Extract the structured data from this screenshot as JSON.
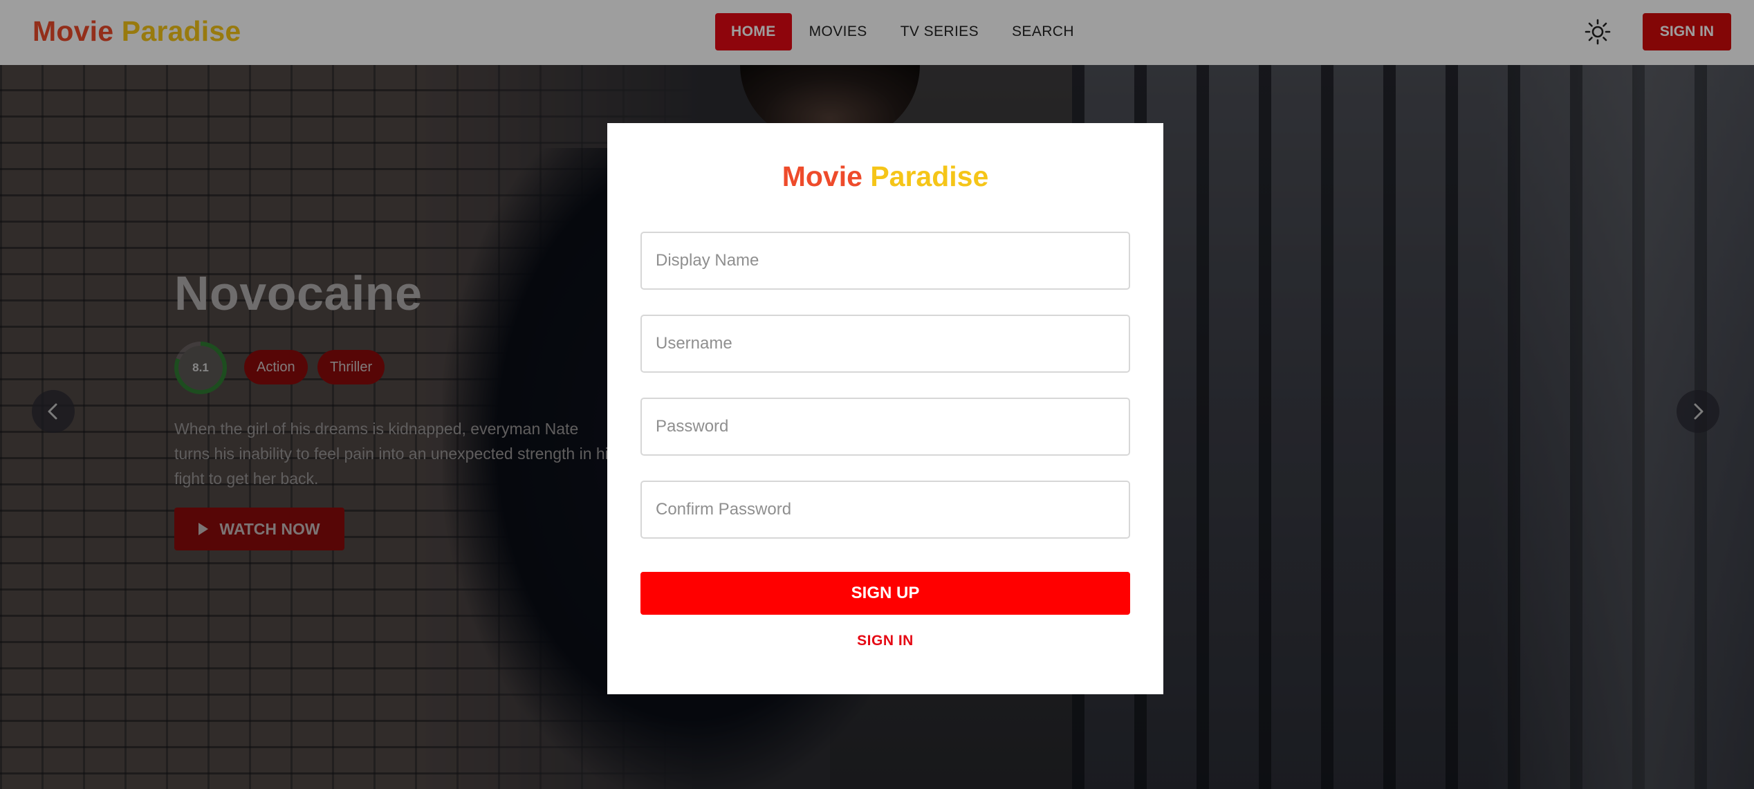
{
  "header": {
    "logo": {
      "word1": "Movie",
      "word2": "Paradise"
    },
    "nav": [
      {
        "label": "HOME",
        "active": true
      },
      {
        "label": "MOVIES",
        "active": false
      },
      {
        "label": "TV SERIES",
        "active": false
      },
      {
        "label": "SEARCH",
        "active": false
      }
    ],
    "theme_icon": "sun-icon",
    "signin_label": "SIGN IN"
  },
  "hero": {
    "title": "Novocaine",
    "rating": "8.1",
    "rating_fraction": 0.81,
    "genres": [
      "Action",
      "Thriller"
    ],
    "description": "When the girl of his dreams is kidnapped, everyman Nate turns his inability to feel pain into an unexpected strength in his fight to get her back.",
    "watch_label": "WATCH NOW",
    "prev_icon": "chevron-left-icon",
    "next_icon": "chevron-right-icon"
  },
  "modal": {
    "logo": {
      "word1": "Movie",
      "word2": "Paradise"
    },
    "fields": {
      "display_name": {
        "placeholder": "Display Name",
        "value": ""
      },
      "username": {
        "placeholder": "Username",
        "value": ""
      },
      "password": {
        "placeholder": "Password",
        "value": ""
      },
      "confirm_password": {
        "placeholder": "Confirm Password",
        "value": ""
      }
    },
    "signup_label": "SIGN UP",
    "signin_label": "SIGN IN"
  },
  "colors": {
    "accent_red": "#e50914",
    "logo_orange": "#ee4b2b",
    "logo_yellow": "#f5c518",
    "signup_red": "#ff0000",
    "rating_green": "#2f7d32"
  }
}
